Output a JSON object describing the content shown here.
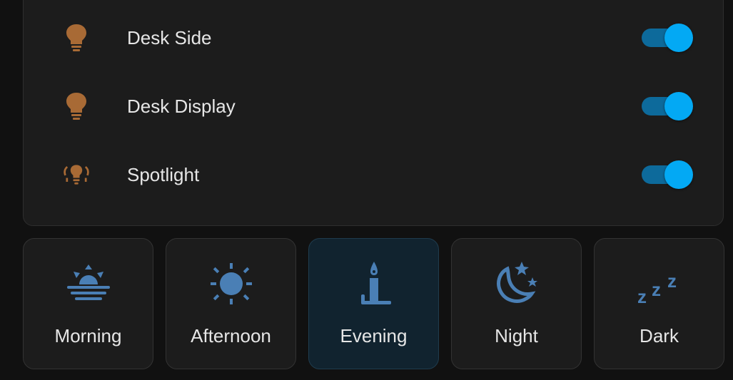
{
  "lights": [
    {
      "label": "Desk Side",
      "icon": "lightbulb-icon",
      "on": true
    },
    {
      "label": "Desk Display",
      "icon": "lightbulb-icon",
      "on": true
    },
    {
      "label": "Spotlight",
      "icon": "spotlight-icon",
      "on": true
    }
  ],
  "scenes": [
    {
      "label": "Morning",
      "icon": "sunrise-icon",
      "active": false
    },
    {
      "label": "Afternoon",
      "icon": "sun-icon",
      "active": false
    },
    {
      "label": "Evening",
      "icon": "candle-icon",
      "active": true
    },
    {
      "label": "Night",
      "icon": "moon-stars-icon",
      "active": false
    },
    {
      "label": "Dark",
      "icon": "sleep-icon",
      "active": false
    }
  ],
  "colors": {
    "light_icon": "#a86a35",
    "scene_icon": "#4a7fb5",
    "toggle_on": "#03a9f4"
  }
}
